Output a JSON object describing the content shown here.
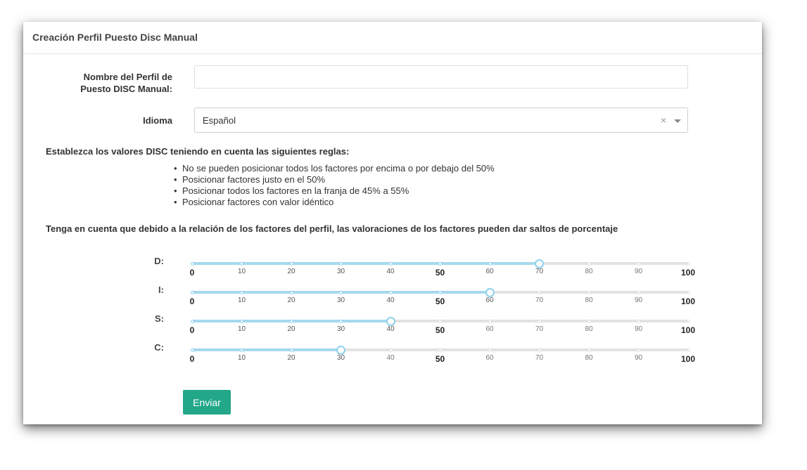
{
  "panel": {
    "title": "Creación Perfil Puesto Disc Manual"
  },
  "form": {
    "name_label": "Nombre del Perfil de Puesto DISC Manual:",
    "name_value": "",
    "language_label": "Idioma",
    "language_value": "Español",
    "clear_symbol": "×"
  },
  "rules": {
    "title": "Establezca los valores DISC teniendo en cuenta las siguientes reglas:",
    "items": [
      "No se pueden posicionar todos los factores por encima o por debajo del 50%",
      "Posicionar factores justo en el 50%",
      "Posicionar todos los factores en la franja de 45% a 55%",
      "Posicionar factores con valor idéntico"
    ]
  },
  "note": "Tenga en cuenta que debido a la relación de los factores del perfil, las valoraciones de los factores pueden dar saltos de porcentaje",
  "sliders": [
    {
      "label": "D:",
      "value": 70
    },
    {
      "label": "I:",
      "value": 60
    },
    {
      "label": "S:",
      "value": 40
    },
    {
      "label": "C:",
      "value": 30
    }
  ],
  "slider_ticks": [
    "0",
    "10",
    "20",
    "30",
    "40",
    "50",
    "60",
    "70",
    "80",
    "90",
    "100"
  ],
  "major_ticks": [
    "0",
    "50",
    "100"
  ],
  "submit_label": "Enviar",
  "colors": {
    "accent": "#22a889",
    "slider_fill": "#a6d9ee",
    "slider_track": "#e2e2e2"
  }
}
